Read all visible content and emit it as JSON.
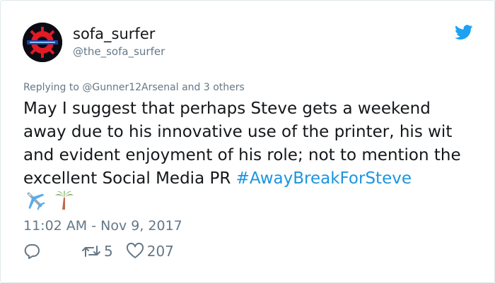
{
  "user": {
    "display_name": "sofa_surfer",
    "handle": "@the_sofa_surfer"
  },
  "tweet": {
    "reply_prefix": "Replying to ",
    "reply_to": "@Gunner12Arsenal",
    "reply_suffix": " and 3 others",
    "text": "May I suggest that perhaps Steve gets a weekend away due to his innovative use of the printer, his wit and evident enjoyment of his role; not to mention the excellent Social Media PR ",
    "hashtag": "#AwayBreakForSteve",
    "emojis": [
      "airplane-icon",
      "palm-tree-icon"
    ],
    "timestamp": "11:02 AM - Nov 9, 2017"
  },
  "actions": {
    "reply_count": "",
    "retweet_count": "5",
    "like_count": "207"
  },
  "icons": {
    "brand": "twitter-bird-icon",
    "reply": "reply-icon",
    "retweet": "retweet-icon",
    "like": "heart-icon"
  },
  "colors": {
    "brand_blue": "#1da1f2",
    "link_blue": "#1b95e0",
    "secondary_text": "#657786"
  }
}
